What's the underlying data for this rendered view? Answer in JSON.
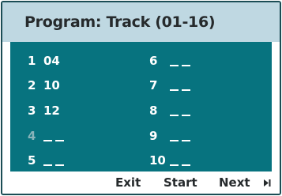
{
  "header": {
    "title": "Program: Track (01-16)"
  },
  "program": {
    "slots": [
      {
        "num": "1",
        "value": "04",
        "dim": false
      },
      {
        "num": "2",
        "value": "10",
        "dim": false
      },
      {
        "num": "3",
        "value": "12",
        "dim": false
      },
      {
        "num": "4",
        "value": "",
        "dim": true
      },
      {
        "num": "5",
        "value": "",
        "dim": false
      },
      {
        "num": "6",
        "value": "",
        "dim": false
      },
      {
        "num": "7",
        "value": "",
        "dim": false
      },
      {
        "num": "8",
        "value": "",
        "dim": false
      },
      {
        "num": "9",
        "value": "",
        "dim": false
      },
      {
        "num": "10",
        "value": "",
        "dim": false
      }
    ]
  },
  "footer": {
    "exit_label": "Exit",
    "start_label": "Start",
    "next_label": "Next",
    "next_icon": "skip-next-icon"
  },
  "colors": {
    "header_bg": "#bfd8e2",
    "panel_bg": "#07737f",
    "text_light": "#ffffff",
    "text_dark": "#262a2c",
    "dim_number": "#88b4ba",
    "border": "#1b4d55"
  }
}
